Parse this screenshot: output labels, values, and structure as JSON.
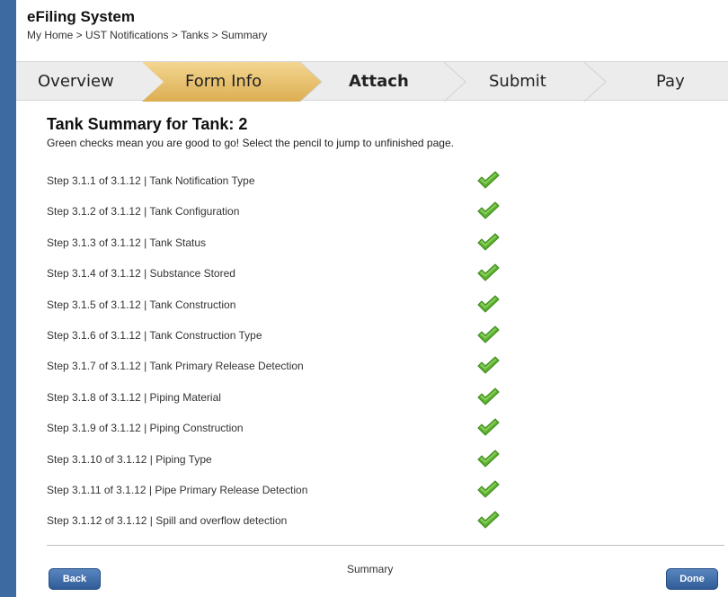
{
  "app": {
    "title": "eFiling System",
    "breadcrumb": "My Home > UST Notifications > Tanks > Summary"
  },
  "wizard": {
    "steps": [
      {
        "label": "Overview",
        "active": false
      },
      {
        "label": "Form Info",
        "active": true
      },
      {
        "label": "Attach",
        "active": false
      },
      {
        "label": "Submit",
        "active": false
      },
      {
        "label": "Pay",
        "active": false
      }
    ],
    "active_color": "#e7c173",
    "inactive_color": "#ececec"
  },
  "summary": {
    "title": "Tank Summary for Tank: 2",
    "subtitle": "Green checks mean you are good to go! Select the pencil to jump to unfinished page.",
    "check_icon": "green-check-icon",
    "check_color": "#5cb030",
    "rows": [
      {
        "label": "Step 3.1.1 of 3.1.12 | Tank Notification Type",
        "complete": true
      },
      {
        "label": "Step 3.1.2 of 3.1.12 | Tank Configuration",
        "complete": true
      },
      {
        "label": "Step 3.1.3 of 3.1.12 | Tank Status",
        "complete": true
      },
      {
        "label": "Step 3.1.4 of 3.1.12 | Substance Stored",
        "complete": true
      },
      {
        "label": "Step 3.1.5 of 3.1.12 | Tank Construction",
        "complete": true
      },
      {
        "label": "Step 3.1.6 of 3.1.12 | Tank Construction Type",
        "complete": true
      },
      {
        "label": "Step 3.1.7 of 3.1.12 | Tank Primary Release Detection",
        "complete": true
      },
      {
        "label": "Step 3.1.8 of 3.1.12 | Piping Material",
        "complete": true
      },
      {
        "label": "Step 3.1.9 of 3.1.12 | Piping Construction",
        "complete": true
      },
      {
        "label": "Step 3.1.10 of 3.1.12 | Piping Type",
        "complete": true
      },
      {
        "label": "Step 3.1.11 of 3.1.12 | Pipe Primary Release Detection",
        "complete": true
      },
      {
        "label": "Step 3.1.12 of 3.1.12 | Spill and overflow detection",
        "complete": true
      }
    ]
  },
  "footer": {
    "back_label": "Back",
    "center_label": "Summary",
    "done_label": "Done"
  }
}
